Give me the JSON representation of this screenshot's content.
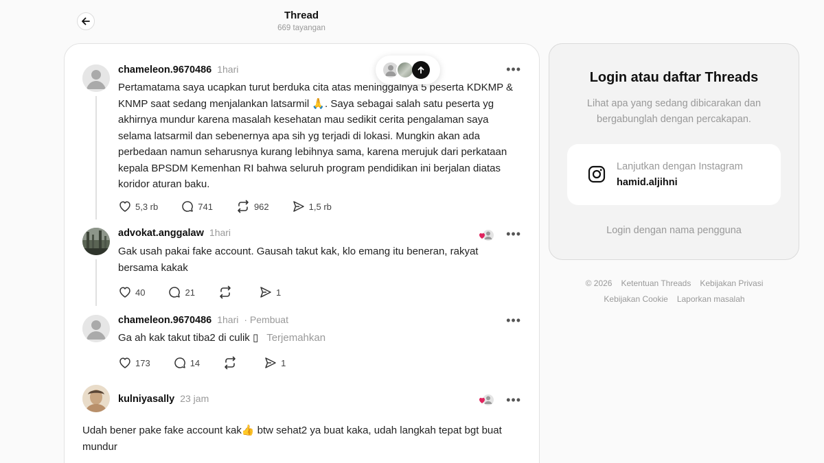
{
  "header": {
    "title": "Thread",
    "views": "669 tayangan"
  },
  "posts": [
    {
      "username": "chameleon.9670486",
      "time": "1hari",
      "text": "Pertamatama saya ucapkan turut berduka cita atas meninggalnya 5 peserta KDKMP & KNMP saat sedang menjalankan latsarmil 🙏. Saya sebagai salah satu peserta yg akhirnya mundur karena masalah kesehatan mau sedikit cerita pengalaman saya selama latsarmil dan sebenernya apa sih yg terjadi di lokasi. Mungkin akan ada perbedaan namun seharusnya kurang lebihnya sama, karena merujuk dari perkataan kepala BPSDM Kemenhan RI bahwa seluruh program pendidikan ini berjalan diatas koridor aturan baku.",
      "likes": "5,3 rb",
      "replies": "741",
      "reposts": "962",
      "shares": "1,5 rb"
    },
    {
      "username": "advokat.anggalaw",
      "time": "1hari",
      "text": "Gak usah pakai fake account. Gausah takut kak, klo emang itu beneran, rakyat bersama kakak",
      "likes": "40",
      "replies": "21",
      "reposts": "",
      "shares": "1"
    },
    {
      "username": "chameleon.9670486",
      "time": "1hari",
      "creator_label": "· Pembuat",
      "text": "Ga ah kak takut tiba2 di culik ▯",
      "translate": "Terjemahkan",
      "likes": "173",
      "replies": "14",
      "reposts": "",
      "shares": "1"
    },
    {
      "username": "kulniyasally",
      "time": "23 jam",
      "text": "Udah bener pake fake account kak👍 btw sehat2 ya buat kaka, udah langkah tepat bgt buat mundur"
    }
  ],
  "login": {
    "title": "Login atau daftar Threads",
    "description": "Lihat apa yang sedang dibicarakan dan bergabunglah dengan percakapan.",
    "instagram_label": "Lanjutkan dengan Instagram",
    "instagram_user": "hamid.aljihni",
    "username_login": "Login dengan nama pengguna"
  },
  "footer": {
    "copyright": "© 2026",
    "terms": "Ketentuan Threads",
    "privacy": "Kebijakan Privasi",
    "cookie": "Kebijakan Cookie",
    "report": "Laporkan masalah"
  },
  "colors": {
    "background": "#fafafa",
    "card": "#ffffff",
    "muted_text": "#999999",
    "primary_text": "#101010",
    "like_heart": "#e0245e"
  },
  "icons": [
    "back-arrow-icon",
    "more-icon",
    "heart-icon",
    "reply-icon",
    "repost-icon",
    "share-icon",
    "instagram-icon",
    "scroll-up-icon"
  ]
}
